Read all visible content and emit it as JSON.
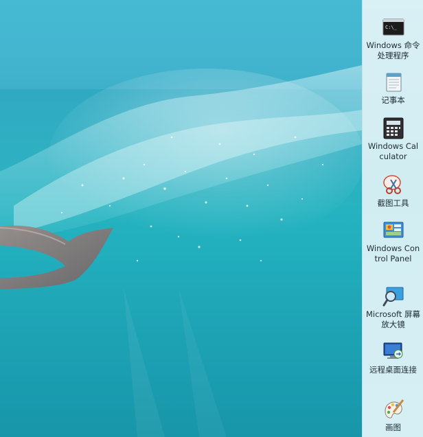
{
  "desktop": {
    "wallpaper": "underwater-ocean-wave",
    "accent_color": "#2fb1c0",
    "panel_color": "#d6eff4"
  },
  "apps": [
    {
      "label": "Windows 命令处理程序",
      "icon": "command-prompt-icon"
    },
    {
      "label": "记事本",
      "icon": "notepad-icon"
    },
    {
      "label": "Windows Calculator",
      "icon": "calculator-icon"
    },
    {
      "label": "截图工具",
      "icon": "snipping-tool-icon"
    },
    {
      "label": "Windows Control Panel",
      "icon": "control-panel-icon"
    },
    {
      "label": "Microsoft 屏幕放大镜",
      "icon": "magnifier-icon"
    },
    {
      "label": "远程桌面连接",
      "icon": "remote-desktop-icon"
    },
    {
      "label": "画图",
      "icon": "paint-icon"
    }
  ]
}
